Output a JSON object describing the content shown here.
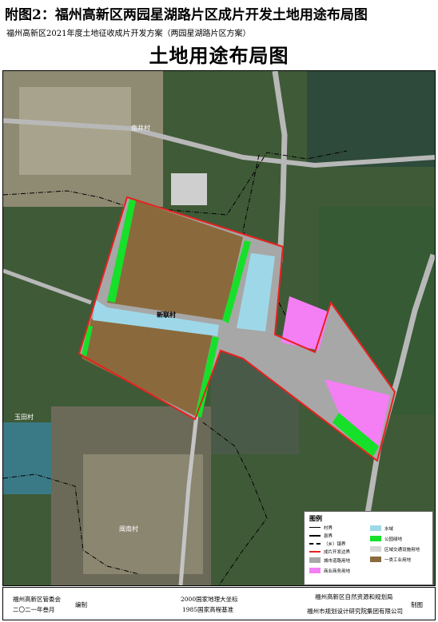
{
  "header": {
    "title": "附图2：福州高新区两园星湖路片区成片开发土地用途布局图",
    "subtitle": "福州高新区2021年度土地征收成片开发方案（两园星湖路片区方案）",
    "map_title": "土地用途布局图"
  },
  "map": {
    "labels": {
      "village_1": "南井村",
      "village_2": "新联村",
      "village_3": "玉田村",
      "village_4": "闽南村"
    },
    "colors": {
      "boundary": "#e8211e",
      "industrial": "#8a6a3c",
      "road": "#a7a7a7",
      "green": "#17e02a",
      "water": "#9ed8e8",
      "commercial": "#f47ef4"
    }
  },
  "legend": {
    "title": "图例",
    "items": [
      {
        "label": "村界",
        "symbol": "village-boundary"
      },
      {
        "label": "县界",
        "symbol": "county-boundary"
      },
      {
        "label": "（乡）镇界",
        "symbol": "town-boundary"
      },
      {
        "label": "成片开发边界",
        "symbol": "development-boundary"
      },
      {
        "label": "城市道路用地",
        "symbol": "road-land"
      },
      {
        "label": "商业商务用地",
        "symbol": "commercial-land"
      },
      {
        "label": "水域",
        "symbol": "water"
      },
      {
        "label": "公园绿地",
        "symbol": "park-green"
      },
      {
        "label": "区域交通设施用地",
        "symbol": "transport-land"
      },
      {
        "label": "一类工业用地",
        "symbol": "industrial-land"
      }
    ]
  },
  "footer": {
    "left_org": "福州高新区管委会",
    "left_date": "二〇二一年叁月",
    "left_action": "编制",
    "center_line1": "2000国家地理大坐标",
    "center_line2": "1985国家高程基准",
    "right_org1": "福州高新区自然资源和规划局",
    "right_org2": "福州市规划设计研究院集团有限公司",
    "right_action": "制图"
  }
}
